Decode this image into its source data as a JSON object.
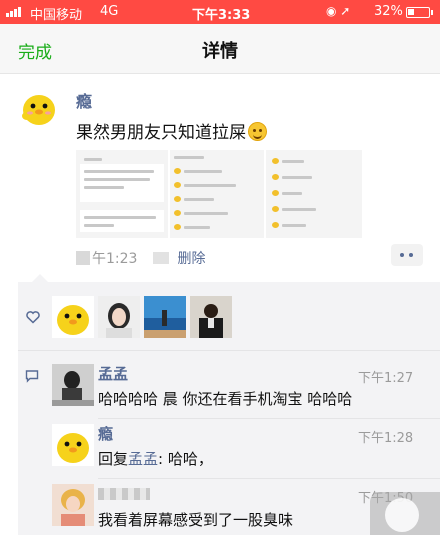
{
  "status_bar": {
    "carrier": "中国移动",
    "network": "4G",
    "time": "下午3:33",
    "battery_percent": "32%",
    "bar_color": "#ff4a43"
  },
  "nav": {
    "done_label": "完成",
    "title": "详情",
    "accent": "#1aad19"
  },
  "post": {
    "author": "瘾",
    "text": "果然男朋友只知道拉屎",
    "emoji_icon": "smile-emoji-icon",
    "time": "午1:23",
    "delete_label": "删除",
    "link_color": "#576b95"
  },
  "comments": [
    {
      "author": "孟孟",
      "time": "下午1:27",
      "text": "哈哈哈哈 晨 你还在看手机淘宝 哈哈哈"
    },
    {
      "author": "瘾",
      "time": "下午1:28",
      "reply_prefix": "回复",
      "reply_to": "孟孟",
      "text": ": 哈哈，"
    },
    {
      "author": "",
      "time": "下午1:50",
      "text": "我看着屏幕感受到了一股臭味"
    }
  ]
}
